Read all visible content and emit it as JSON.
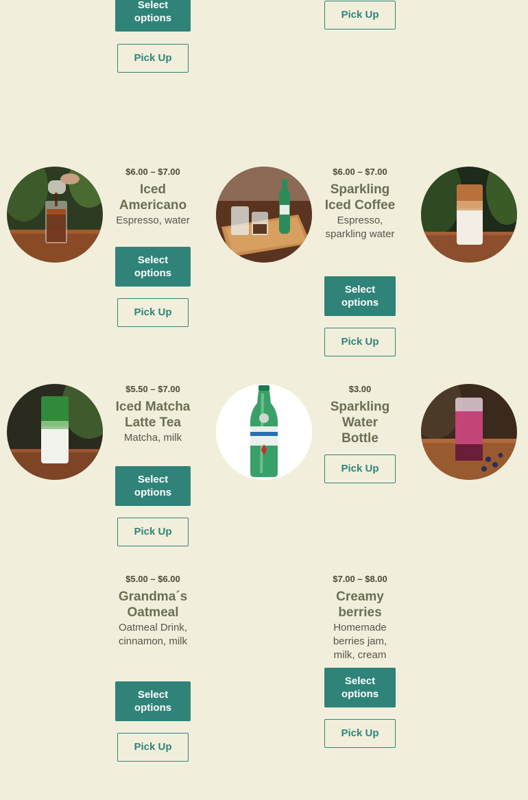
{
  "top_partial": {
    "left_select_label": "Select options",
    "left_pickup_label": "Pick Up",
    "right_pickup_label": "Pick Up"
  },
  "products": [
    {
      "price": "$6.00 – $7.00",
      "title": "Iced Americano",
      "desc": "Espresso, water",
      "select_label": "Select options",
      "pickup_label": "Pick Up",
      "image": "iced-americano"
    },
    {
      "price": "$6.00 – $7.00",
      "title": "Sparkling Iced Coffee",
      "desc": "Espresso, sparkling water",
      "select_label": "Select options",
      "pickup_label": "Pick Up",
      "image": "sparkling-iced-coffee"
    },
    {
      "price": "$5.50 – $7.00",
      "title": "Iced Matcha Latte Tea",
      "desc": "Matcha, milk",
      "select_label": "Select options",
      "pickup_label": "Pick Up",
      "image": "iced-matcha-latte"
    },
    {
      "price": "$3.00",
      "title": "Sparkling Water Bottle",
      "desc": "",
      "select_label": "",
      "pickup_label": "Pick Up",
      "image": "s-pellegrino-bottle"
    },
    {
      "price": "$5.00 – $6.00",
      "title": "Grandma´s Oatmeal",
      "desc": "Oatmeal Drink, cinnamon, milk",
      "select_label": "Select options",
      "pickup_label": "Pick Up",
      "image": ""
    },
    {
      "price": "$7.00 – $8.00",
      "title": "Creamy berries",
      "desc": "Homemade berries jam, milk, cream",
      "select_label": "Select options",
      "pickup_label": "Pick Up",
      "image": ""
    }
  ],
  "extra_images": [
    "iced-latte",
    "berry-iced-drink"
  ],
  "colors": {
    "background": "#f1efdc",
    "accent": "#2f8378",
    "title": "#6b6f52",
    "price": "#4b4a3a"
  }
}
